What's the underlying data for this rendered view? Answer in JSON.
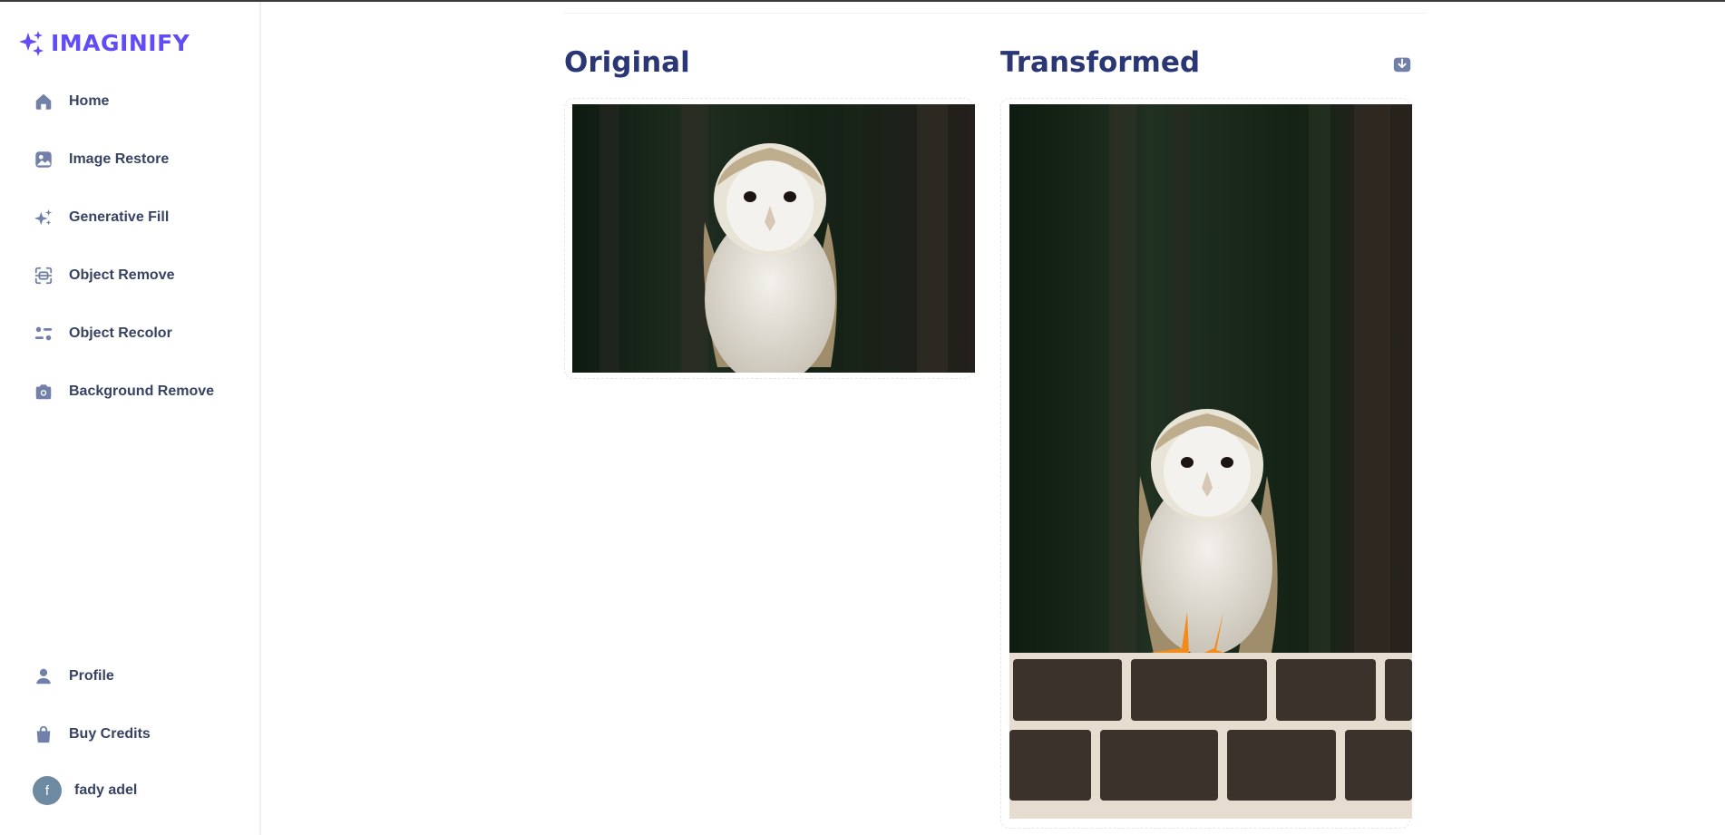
{
  "app": {
    "name": "IMAGINIFY"
  },
  "sidebar": {
    "items": [
      {
        "label": "Home",
        "icon": "home-icon"
      },
      {
        "label": "Image Restore",
        "icon": "image-icon"
      },
      {
        "label": "Generative Fill",
        "icon": "sparkles-icon"
      },
      {
        "label": "Object Remove",
        "icon": "scan-icon"
      },
      {
        "label": "Object Recolor",
        "icon": "filter-icon"
      },
      {
        "label": "Background Remove",
        "icon": "camera-icon"
      }
    ],
    "bottom_items": [
      {
        "label": "Profile",
        "icon": "user-icon"
      },
      {
        "label": "Buy Credits",
        "icon": "bag-icon"
      }
    ],
    "user": {
      "initial": "f",
      "name": "fady adel"
    }
  },
  "main": {
    "original_title": "Original",
    "transformed_title": "Transformed",
    "download_icon": "download-icon",
    "original_image": "owl-on-dark-forest-background",
    "transformed_image": "owl-standing-on-brick-wall"
  },
  "colors": {
    "brand": "#624cf5",
    "heading": "#2b3674",
    "nav_text": "#384262",
    "nav_icon": "#7080a8"
  }
}
